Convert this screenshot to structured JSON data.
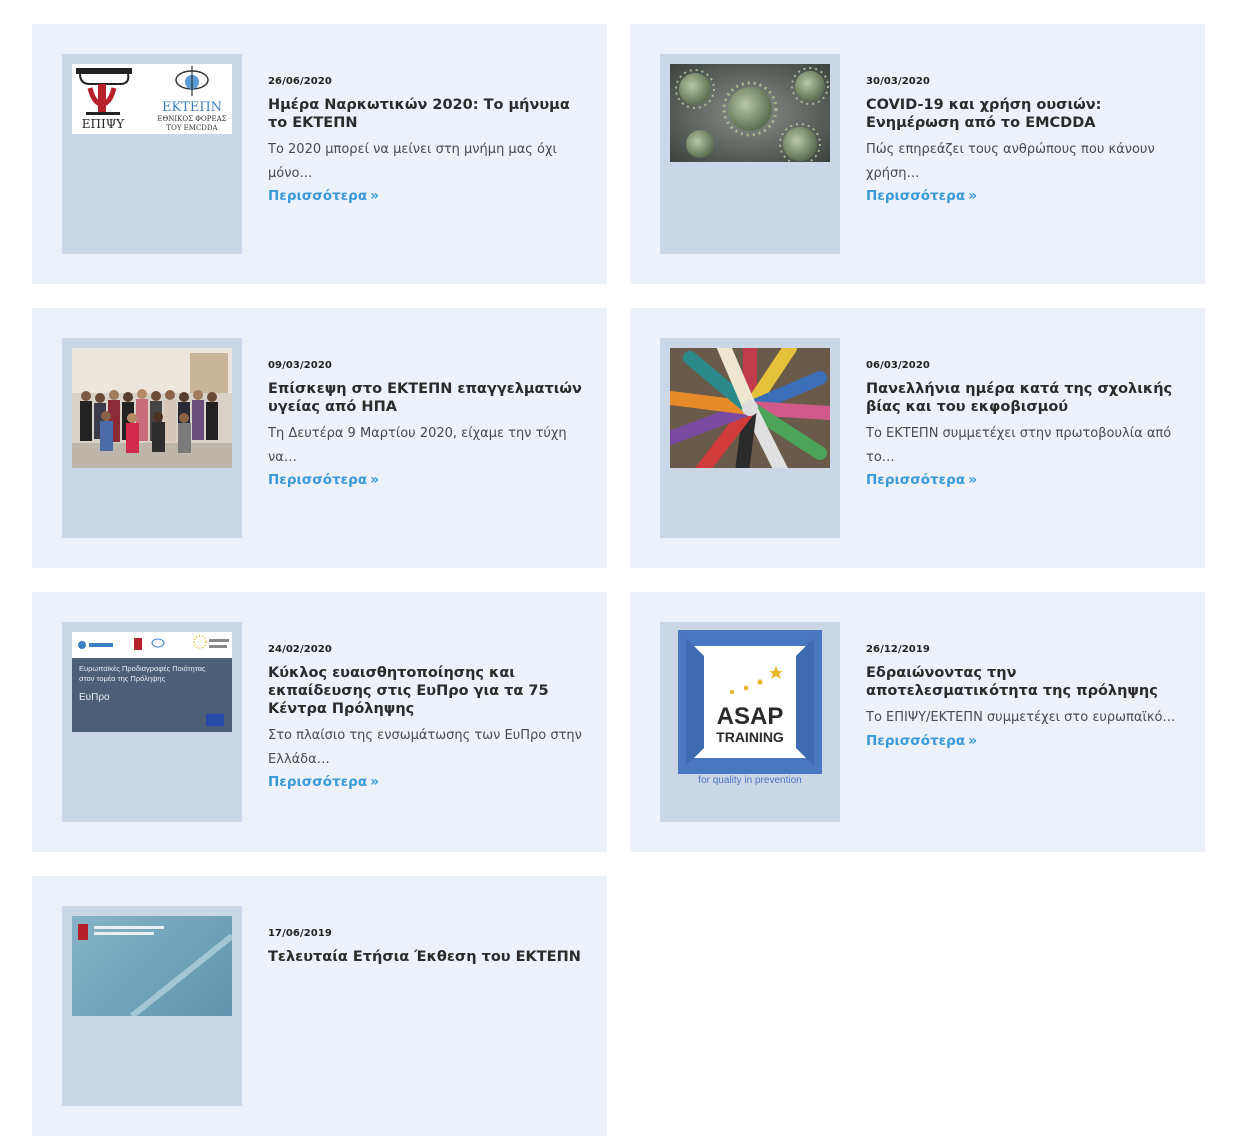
{
  "read_more_label": "Περισσότερα",
  "read_more_icon": "chevron-double-right-icon",
  "accent_color": "#3a9ad9",
  "articles": [
    {
      "date": "26/06/2020",
      "title": "Ημέρα Ναρκωτικών 2020: Το μήνυμα το ΕΚΤΕΠΝ",
      "excerpt": "Το 2020 μπορεί να μείνει στη μνήμη μας όχι μόνο…",
      "image_text": {
        "left_logo": "ΕΠΙΨΥ",
        "right_logo": "ΕΚΤΕΠΝ",
        "right_sub1": "ΕΘΝΙΚΟΣ ΦΟΡΕΑΣ",
        "right_sub2": "ΤΟΥ EMCDDA"
      }
    },
    {
      "date": "30/03/2020",
      "title": "COVID-19 και χρήση ουσιών: Ενημέρωση από το EMCDDA",
      "excerpt": "Πώς επηρεάζει τους ανθρώπους που κάνουν χρήση…"
    },
    {
      "date": "09/03/2020",
      "title": "Επίσκεψη στο ΕΚΤΕΠΝ επαγγελματιών υγείας από ΗΠΑ",
      "excerpt": "Τη Δευτέρα 9 Μαρτίου 2020, είχαμε την τύχη να…"
    },
    {
      "date": "06/03/2020",
      "title": "Πανελλήνια ημέρα κατά της σχολικής βίας και του εκφοβισμού",
      "excerpt": "Το ΕΚΤΕΠΝ συμμετέχει στην πρωτοβουλία από το…"
    },
    {
      "date": "24/02/2020",
      "title": "Κύκλος ευαισθητοποίησης και εκπαίδευσης στις ΕυΠρο για τα 75 Κέντρα Πρόληψης",
      "excerpt": "Στο πλαίσιο της ενσωμάτωσης των ΕυΠρο στην Ελλάδα…",
      "image_text": {
        "line1": "Ευρωπαϊκές Προδιαγραφές Ποιότητας",
        "line2": "στον τομέα της Πρόληψης",
        "line3": "ΕυΠρο"
      }
    },
    {
      "date": "26/12/2019",
      "title": "Εδραιώνοντας την αποτελεσματικότητα της πρόληψης",
      "excerpt": "Το ΕΠΙΨΥ/ΕΚΤΕΠΝ συμμετέχει στο ευρωπαϊκό…",
      "image_text": {
        "line1": "ASAP",
        "line2": "TRAINING",
        "line3": "for quality in prevention"
      }
    },
    {
      "date": "17/06/2019",
      "title": "Τελευταία Ετήσια Έκθεση του ΕΚΤΕΠΝ",
      "excerpt": ""
    }
  ]
}
